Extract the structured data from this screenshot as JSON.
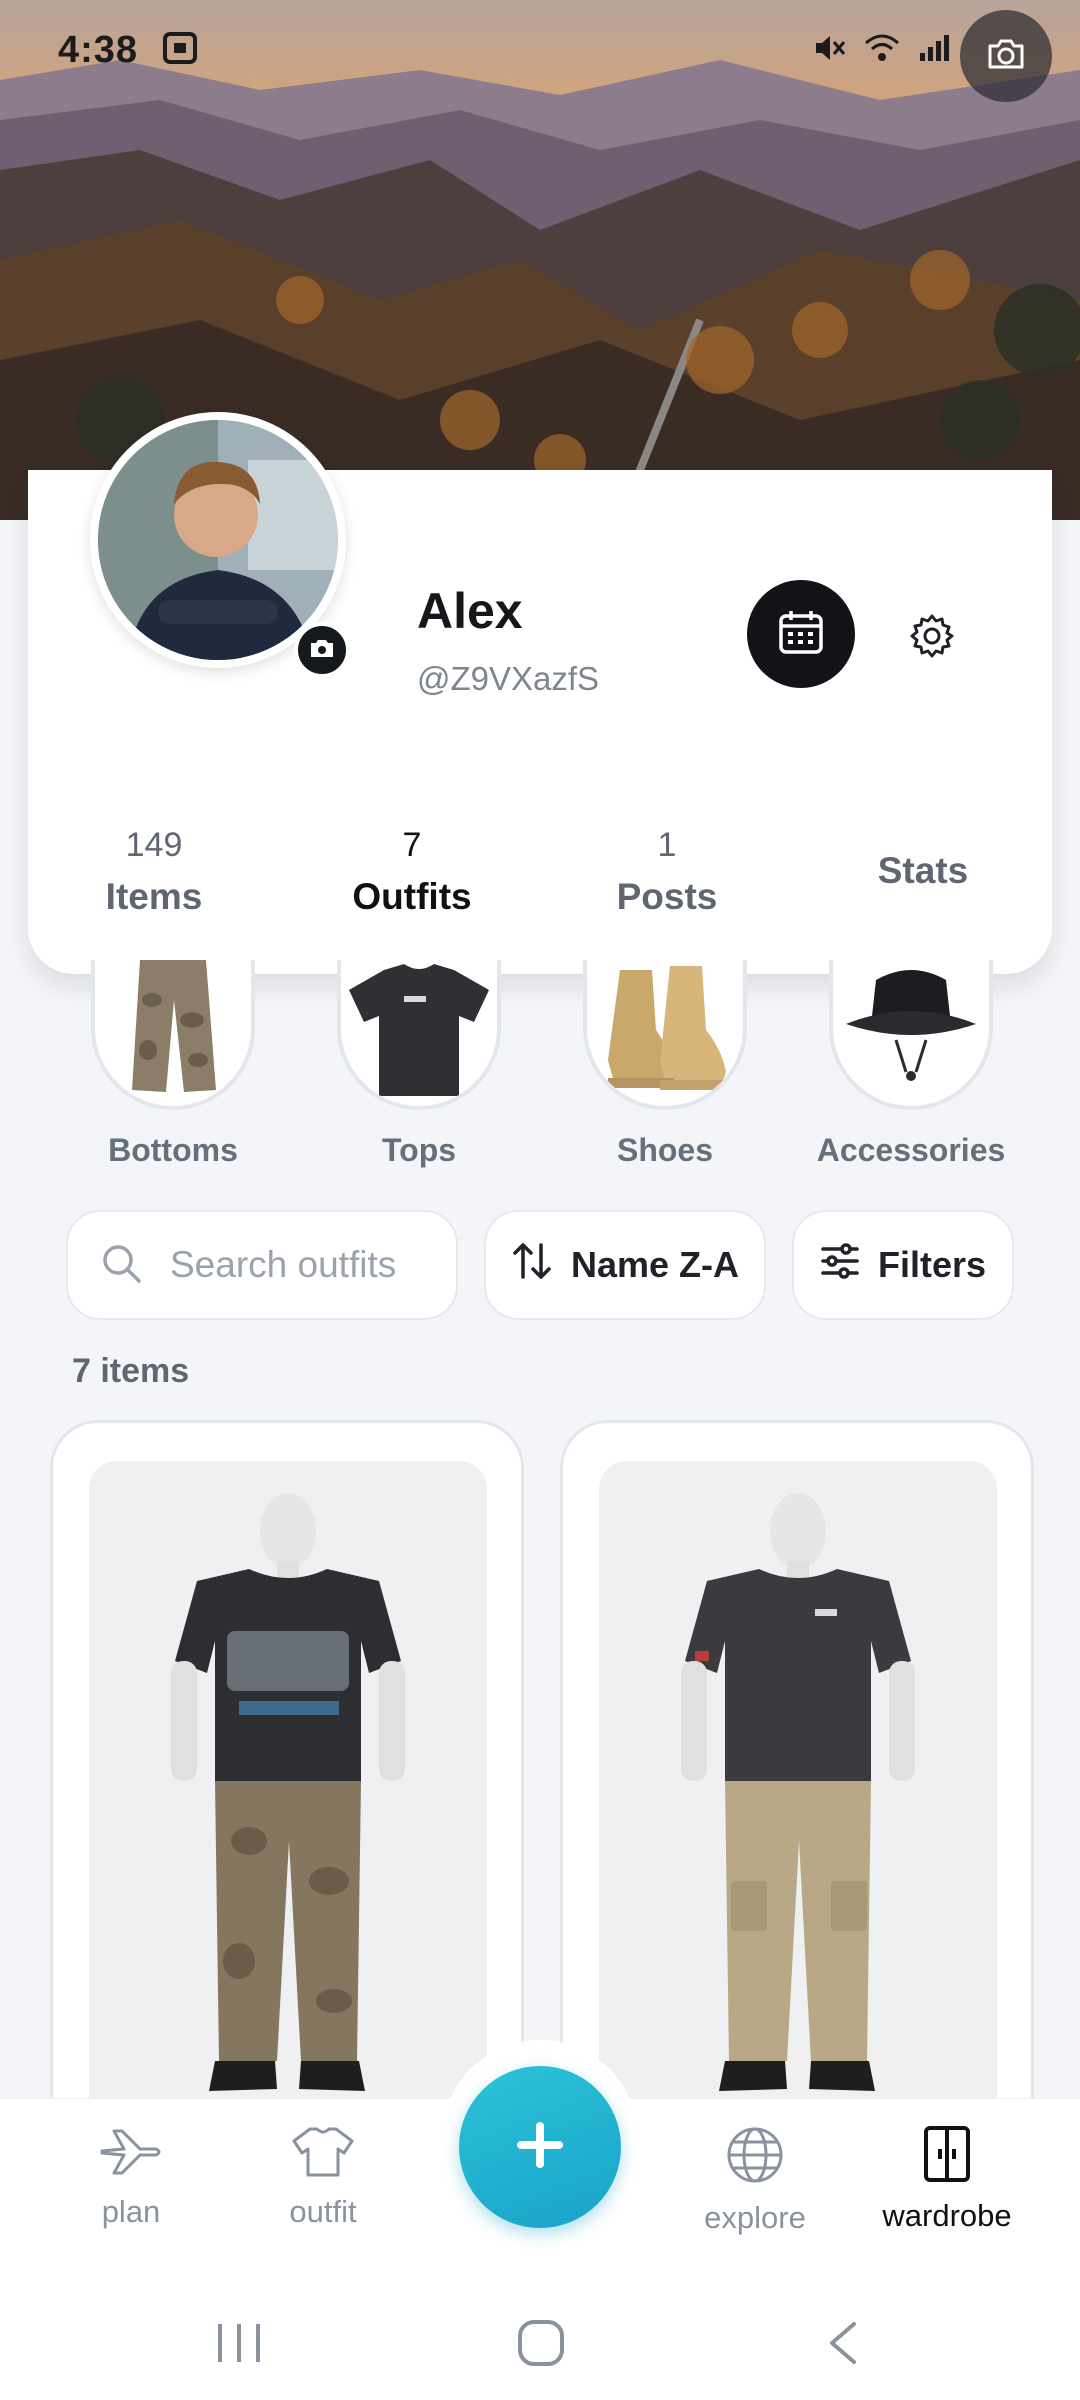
{
  "status_bar": {
    "time": "4:38"
  },
  "profile": {
    "name": "Alex",
    "handle": "@Z9VXazfS"
  },
  "stats": [
    {
      "num": "149",
      "label": "Items"
    },
    {
      "num": "7",
      "label": "Outfits"
    },
    {
      "num": "1",
      "label": "Posts"
    },
    {
      "label": "Stats"
    }
  ],
  "categories": [
    {
      "label": "Bottoms",
      "icon": "cargo-pants"
    },
    {
      "label": "Tops",
      "icon": "t-shirt"
    },
    {
      "label": "Shoes",
      "icon": "sneakers"
    },
    {
      "label": "Accessories",
      "icon": "bucket-hat"
    }
  ],
  "toolbar": {
    "search_placeholder": "Search outfits",
    "sort_label": "Name Z-A",
    "filters_label": "Filters"
  },
  "items_count": "7 items",
  "nav": {
    "plan": "plan",
    "outfit": "outfit",
    "explore": "explore",
    "wardrobe": "wardrobe"
  },
  "colors": {
    "accent": "#1fb0cf",
    "text_dark": "#15171a",
    "muted": "#66707b"
  }
}
